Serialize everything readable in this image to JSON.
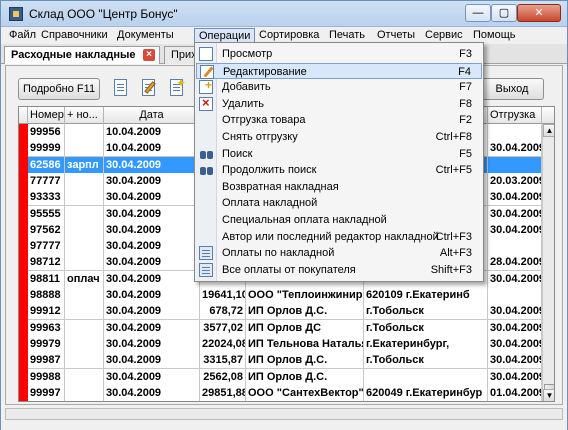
{
  "window": {
    "title": "Склад ООО \"Центр Бонус\"",
    "min_label": "—",
    "max_label": "▢",
    "close_label": "✕"
  },
  "menu": [
    "Файл",
    "Справочники",
    "Документы",
    "Операции",
    "Сортировка",
    "Печать",
    "Отчеты",
    "Сервис",
    "Помощь"
  ],
  "tabs": [
    {
      "label": "Расходные накладные",
      "close": "×"
    },
    {
      "label": "Прих"
    }
  ],
  "toolbar": {
    "detail_label": "Подробно F11",
    "exit_label": "Выход"
  },
  "grid": {
    "headers": [
      "Номер",
      "+ но...",
      "Дата",
      "",
      "",
      "",
      "Отгрузка"
    ],
    "rows": [
      {
        "num": "99956",
        "extra": "",
        "date": "10.04.2009",
        "sum": "",
        "client": "",
        "addr": "",
        "ship": ""
      },
      {
        "num": "99999",
        "extra": "",
        "date": "10.04.2009",
        "sum": "",
        "client": "",
        "addr": "",
        "ship": "30.04.2009"
      },
      {
        "num": "62586",
        "extra": "зарпл",
        "date": "30.04.2009",
        "sum": "",
        "client": "",
        "addr": "",
        "ship": ""
      },
      {
        "num": "77777",
        "extra": "",
        "date": "30.04.2009",
        "sum": "",
        "client": "",
        "addr": "",
        "ship": "20.03.2009"
      },
      {
        "num": "93333",
        "extra": "",
        "date": "30.04.2009",
        "sum": "",
        "client": "",
        "addr": "",
        "ship": "30.04.2009"
      },
      {
        "num": "95555",
        "extra": "",
        "date": "30.04.2009",
        "sum": "",
        "client": "",
        "addr": "",
        "ship": "30.04.2009"
      },
      {
        "num": "97562",
        "extra": "",
        "date": "30.04.2009",
        "sum": "",
        "client": "",
        "addr": "",
        "ship": "30.04.2009"
      },
      {
        "num": "97777",
        "extra": "",
        "date": "30.04.2009",
        "sum": "",
        "client": "",
        "addr": "",
        "ship": ""
      },
      {
        "num": "98712",
        "extra": "",
        "date": "30.04.2009",
        "sum": "",
        "client": "",
        "addr": "",
        "ship": "28.04.2009"
      },
      {
        "num": "98811",
        "extra": "оплач",
        "date": "30.04.2009",
        "sum": "",
        "client": "",
        "addr": "",
        "ship": "30.04.2009"
      },
      {
        "num": "98888",
        "extra": "",
        "date": "30.04.2009",
        "sum": "19641,10",
        "client": "ООО \"Теплоинжиниринг",
        "addr": "620109 г.Екатеринб",
        "ship": ""
      },
      {
        "num": "99912",
        "extra": "",
        "date": "30.04.2009",
        "sum": "678,72",
        "client": "ИП Орлов Д.С.",
        "addr": "г.Тобольск",
        "ship": "30.04.2009"
      },
      {
        "num": "99963",
        "extra": "",
        "date": "30.04.2009",
        "sum": "3577,02",
        "client": "ИП Орлов ДС",
        "addr": "г.Тобольск",
        "ship": "30.04.2009"
      },
      {
        "num": "99979",
        "extra": "",
        "date": "30.04.2009",
        "sum": "22024,08",
        "client": "ИП Тельнова Наталья В",
        "addr": "г.Екатеринбург,",
        "ship": "30.04.2009"
      },
      {
        "num": "99987",
        "extra": "",
        "date": "30.04.2009",
        "sum": "3315,87",
        "client": "ИП Орлов Д.С.",
        "addr": "г.Тобольск",
        "ship": "30.04.2009"
      },
      {
        "num": "99988",
        "extra": "",
        "date": "30.04.2009",
        "sum": "2562,08",
        "client": "ИП Орлов Д.С.",
        "addr": "",
        "ship": "30.04.2009"
      },
      {
        "num": "99997",
        "extra": "",
        "date": "30.04.2009",
        "sum": "29851,88",
        "client": "ООО \"СантехВектор\"",
        "addr": "620049 г.Екатеринбур",
        "ship": "01.04.2009"
      }
    ]
  },
  "dropdown": [
    {
      "label": "Просмотр",
      "shortcut": "F3",
      "icon": "view-icon"
    },
    {
      "label": "Редактирование",
      "shortcut": "F4",
      "icon": "edit-icon"
    },
    {
      "label": "Добавить",
      "shortcut": "F7",
      "icon": "add-icon"
    },
    {
      "label": "Удалить",
      "shortcut": "F8",
      "icon": "delete-icon"
    },
    {
      "label": "Отгрузка товара",
      "shortcut": "F2",
      "icon": ""
    },
    {
      "label": "Снять отгрузку",
      "shortcut": "Ctrl+F8",
      "icon": ""
    },
    {
      "label": "Поиск",
      "shortcut": "F5",
      "icon": "binoculars-icon"
    },
    {
      "label": "Продолжить поиск",
      "shortcut": "Ctrl+F5",
      "icon": "binoculars-icon"
    },
    {
      "label": "Возвратная накладная",
      "shortcut": "",
      "icon": ""
    },
    {
      "label": "Оплата накладной",
      "shortcut": "",
      "icon": ""
    },
    {
      "label": "Специальная оплата накладной",
      "shortcut": "",
      "icon": ""
    },
    {
      "label": "Автор или последний редактор накладной",
      "shortcut": "Ctrl+F3",
      "icon": ""
    },
    {
      "label": "Оплаты по накладной",
      "shortcut": "Alt+F3",
      "icon": "payments-icon"
    },
    {
      "label": "Все оплаты от покупателя",
      "shortcut": "Shift+F3",
      "icon": "payments-icon"
    }
  ]
}
